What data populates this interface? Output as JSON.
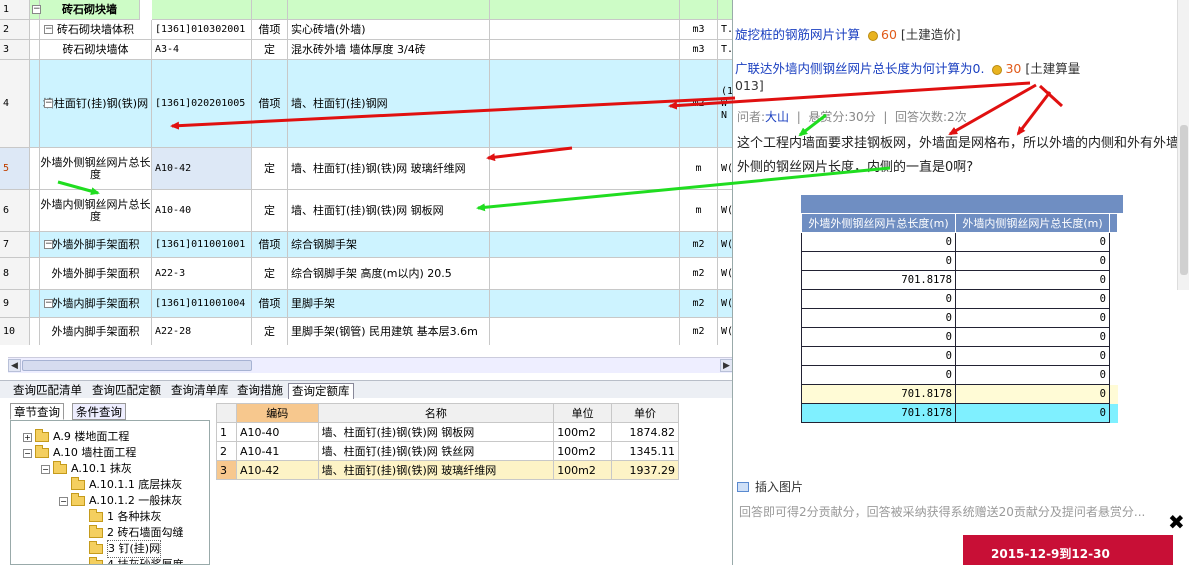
{
  "grid": {
    "rows": [
      {
        "no": "1",
        "name": "砖石砌块墙",
        "code": "",
        "type": "",
        "desc": "",
        "unit": "",
        "extra": "",
        "expander": "−",
        "bg": "#cdfcc6",
        "bold": true
      },
      {
        "no": "2",
        "name": "砖石砌块墙体积",
        "code": "[1361]010302001",
        "type": "借项",
        "desc": "实心砖墙(外墙)",
        "unit": "m3",
        "extra": "T.",
        "expander": "−",
        "bg": "#ffffff"
      },
      {
        "no": "3",
        "name": "砖石砌块墙体",
        "code": "A3-4",
        "type": "定",
        "desc": "混水砖外墙 墙体厚度 3/4砖",
        "unit": "m3",
        "extra": "T.",
        "expander": "",
        "bg": "#ffffff"
      },
      {
        "no": "4",
        "name": "墙柱面钉(挂)钢(铁)网",
        "code": "[1361]020201005",
        "type": "借项",
        "desc": "墙、柱面钉(挂)钢网",
        "unit": "m2",
        "extra": "(1 W N",
        "expander": "−",
        "bg": "#cdf3ff"
      },
      {
        "no": "5",
        "name": "外墙外侧钢丝网片总长度",
        "code": "A10-42",
        "type": "定",
        "desc": "墙、柱面钉(挂)钢(铁)网 玻璃纤维网",
        "unit": "m",
        "extra": "W(",
        "expander": "",
        "bg": "#ffffff",
        "codebg": "#dde8f6"
      },
      {
        "no": "6",
        "name": "外墙内侧钢丝网片总长度",
        "code": "A10-40",
        "type": "定",
        "desc": "墙、柱面钉(挂)钢(铁)网 钢板网",
        "unit": "m",
        "extra": "W(",
        "expander": "",
        "bg": "#ffffff"
      },
      {
        "no": "7",
        "name": "外墙外脚手架面积",
        "code": "[1361]011001001",
        "type": "借项",
        "desc": "综合钢脚手架",
        "unit": "m2",
        "extra": "W(",
        "expander": "−",
        "bg": "#cdf3ff"
      },
      {
        "no": "8",
        "name": "外墙外脚手架面积",
        "code": "A22-3",
        "type": "定",
        "desc": "综合钢脚手架 高度(m以内) 20.5",
        "unit": "m2",
        "extra": "W(",
        "expander": "",
        "bg": "#ffffff"
      },
      {
        "no": "9",
        "name": "外墙内脚手架面积",
        "code": "[1361]011001004",
        "type": "借项",
        "desc": "里脚手架",
        "unit": "m2",
        "extra": "W(",
        "expander": "−",
        "bg": "#cdf3ff"
      },
      {
        "no": "10",
        "name": "外墙内脚手架面积",
        "code": "A22-28",
        "type": "定",
        "desc": "里脚手架(钢管) 民用建筑 基本层3.6m",
        "unit": "m2",
        "extra": "W(",
        "expander": "",
        "bg": "#ffffff"
      }
    ]
  },
  "query_tabs": [
    "查询匹配清单",
    "查询匹配定额",
    "查询清单库",
    "查询措施",
    "查询定额库"
  ],
  "sub_tabs": [
    "章节查询",
    "条件查询"
  ],
  "tree": [
    {
      "label": "A.9 楼地面工程",
      "pm": "+",
      "level": 0
    },
    {
      "label": "A.10 墙柱面工程",
      "pm": "−",
      "level": 0
    },
    {
      "label": "A.10.1 抹灰",
      "pm": "−",
      "level": 1
    },
    {
      "label": "A.10.1.1 底层抹灰",
      "pm": "",
      "level": 2
    },
    {
      "label": "A.10.1.2 一般抹灰",
      "pm": "−",
      "level": 2
    },
    {
      "label": "1 各种抹灰",
      "pm": "",
      "level": 3
    },
    {
      "label": "2 砖石墙面勾缝",
      "pm": "",
      "level": 3
    },
    {
      "label": "3 钉(挂)网",
      "pm": "",
      "level": 3,
      "sel": true
    },
    {
      "label": "4 抹灰砂浆厚度",
      "pm": "",
      "level": 3
    }
  ],
  "lib": {
    "headers": [
      "编码",
      "名称",
      "单位",
      "单价"
    ],
    "rows": [
      {
        "no": "1",
        "code": "A10-40",
        "name": "墙、柱面钉(挂)钢(铁)网 钢板网",
        "unit": "100m2",
        "price": "1874.82"
      },
      {
        "no": "2",
        "code": "A10-41",
        "name": "墙、柱面钉(挂)钢(铁)网 铁丝网",
        "unit": "100m2",
        "price": "1345.11"
      },
      {
        "no": "3",
        "code": "A10-42",
        "name": "墙、柱面钉(挂)钢(铁)网 玻璃纤维网",
        "unit": "100m2",
        "price": "1937.29"
      }
    ]
  },
  "qa": {
    "link1": "旋挖桩的钢筋网片计算",
    "link1_score": "60",
    "link1_cat": "[土建造价]",
    "link2": "广联达外墙内侧钢丝网片总长度为何计算为0.",
    "link2_score": "30",
    "link2_cat": "[土建算量",
    "link2_cat2": "013]",
    "meta_user_label": "问者:",
    "meta_user": "大山",
    "meta_reward": "悬赏分:30分",
    "meta_answers": "回答次数:2次",
    "question": "这个工程内墙面要求挂钢板网，外墙面是网格布，所以外墙的内侧和外有外墙外侧的钢丝网片长度，内侧的一直是0啊?",
    "insert_label": "插入图片",
    "hint": "回答即可得2分贡献分，回答被采纳获得系统赠送20贡献分及提问者悬赏分...",
    "banner": "2015-12-9到12-30"
  },
  "inner_table": {
    "headers": [
      "外墙外侧钢丝网片总长度(m)",
      "外墙内侧钢丝网片总长度(m)"
    ],
    "rows": [
      [
        "0",
        "0"
      ],
      [
        "0",
        "0"
      ],
      [
        "701.8178",
        "0"
      ],
      [
        "0",
        "0"
      ],
      [
        "0",
        "0"
      ],
      [
        "0",
        "0"
      ],
      [
        "0",
        "0"
      ],
      [
        "0",
        "0"
      ],
      [
        "701.8178",
        "0"
      ],
      [
        "701.8178",
        "0"
      ]
    ]
  },
  "colors": {
    "arrow_red": "#e01010",
    "arrow_green": "#20dd20"
  }
}
